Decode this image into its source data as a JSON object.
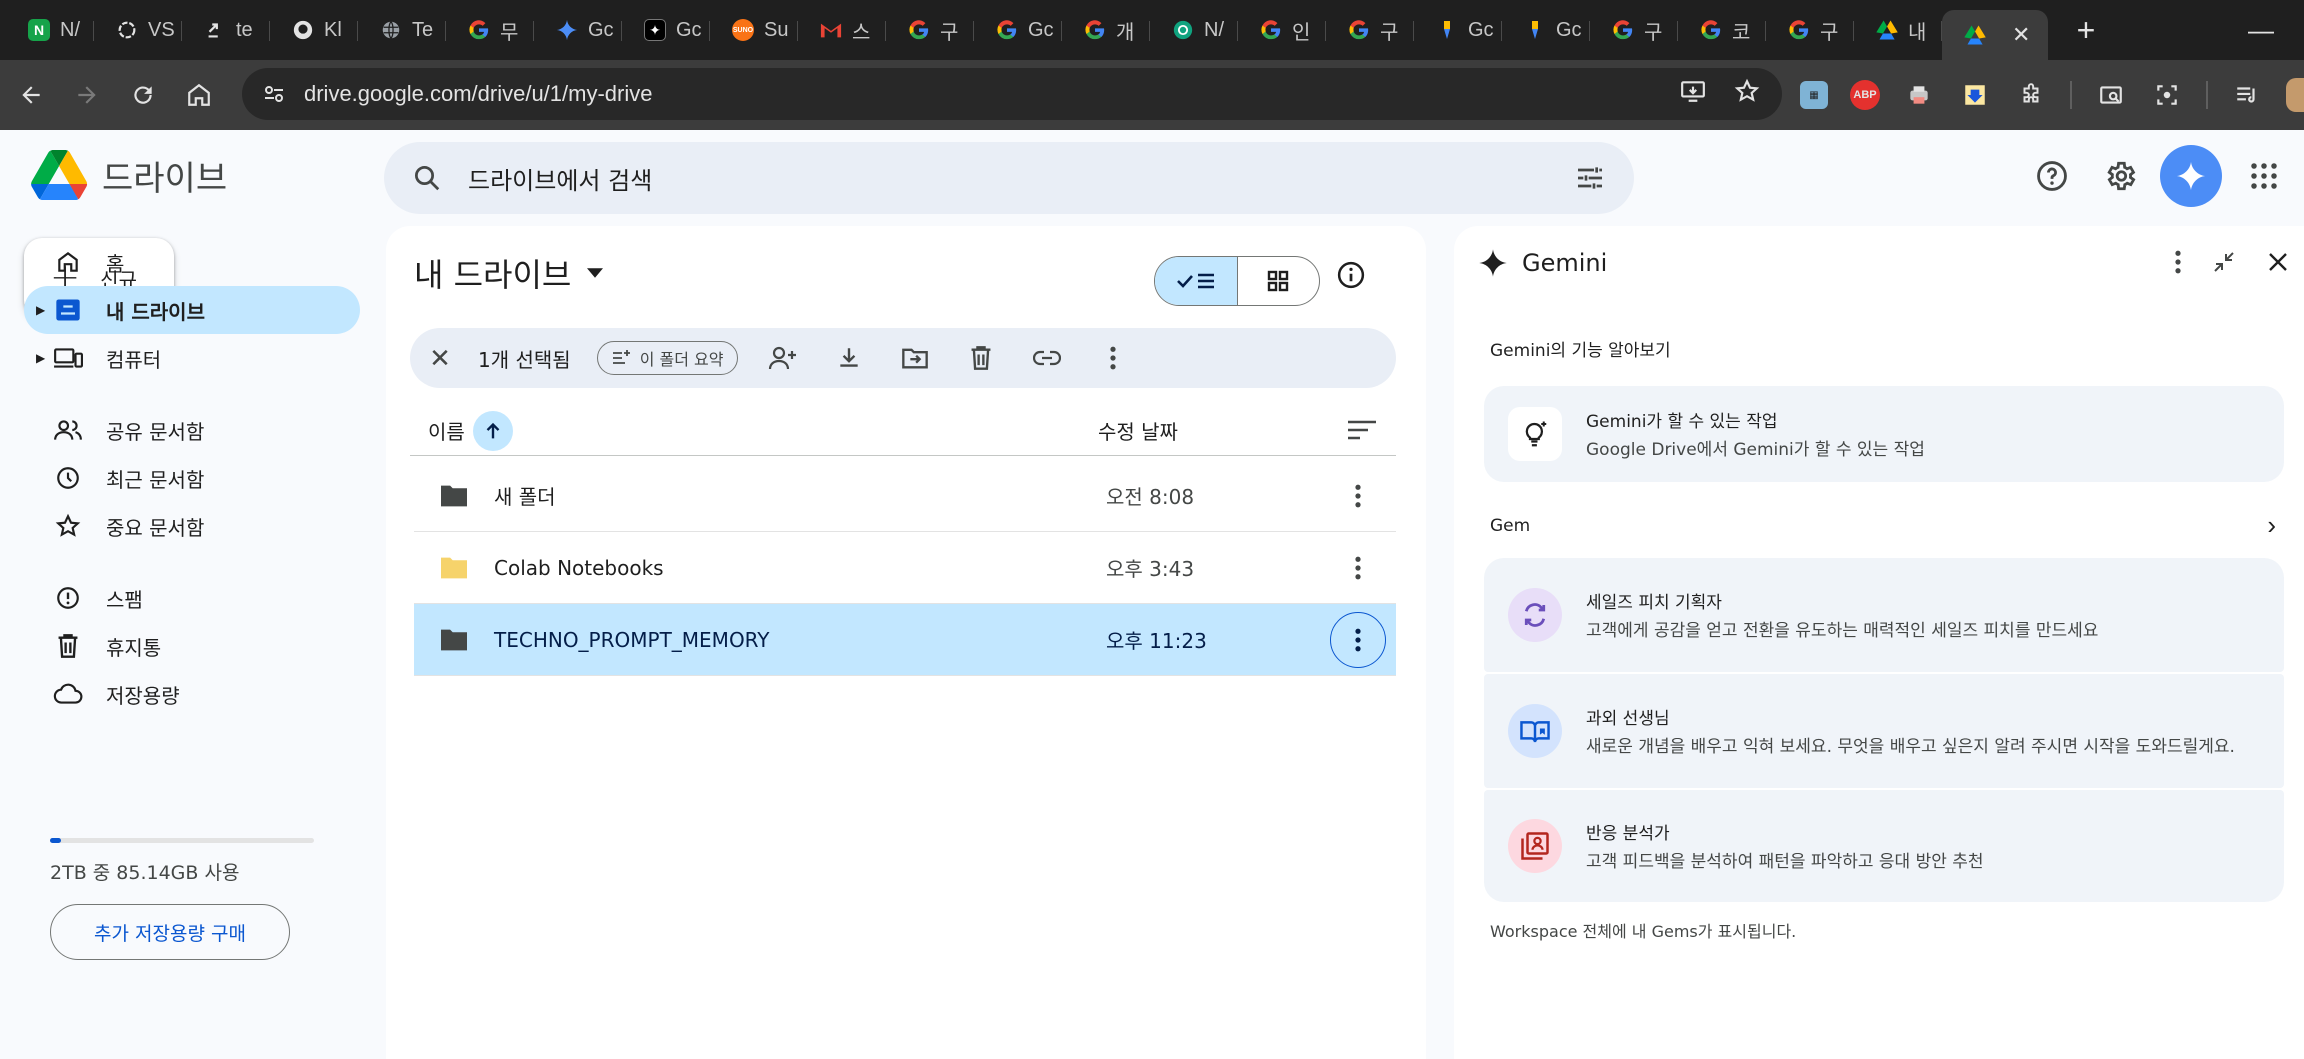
{
  "browser": {
    "tabs": [
      {
        "label": "N/",
        "icon": "notion-icon",
        "color": "#16a34a"
      },
      {
        "label": "VS",
        "icon": "openai-icon",
        "color": "#e3e3e3"
      },
      {
        "label": "te",
        "icon": "link-icon",
        "color": "#e3e3e3"
      },
      {
        "label": "Kl",
        "icon": "github-icon",
        "color": "#e3e3e3"
      },
      {
        "label": "Te",
        "icon": "globe-icon",
        "color": "#9aa0a6"
      },
      {
        "label": "무",
        "icon": "google-icon",
        "color": "#4285f4"
      },
      {
        "label": "Gc",
        "icon": "gemini-icon",
        "color": "#4c8df6"
      },
      {
        "label": "Gc",
        "icon": "gemini-dark-icon",
        "color": "#000000"
      },
      {
        "label": "Su",
        "icon": "suno-icon",
        "color": "#f97316"
      },
      {
        "label": "스",
        "icon": "gmail-icon",
        "color": "#ea4335"
      },
      {
        "label": "구",
        "icon": "google-icon",
        "color": "#4285f4"
      },
      {
        "label": "Gc",
        "icon": "google-icon",
        "color": "#4285f4"
      },
      {
        "label": "개",
        "icon": "google-icon",
        "color": "#4285f4"
      },
      {
        "label": "N/",
        "icon": "chatgpt-icon",
        "color": "#10a37f"
      },
      {
        "label": "인",
        "icon": "google-icon",
        "color": "#4285f4"
      },
      {
        "label": "구",
        "icon": "google-icon",
        "color": "#4285f4"
      },
      {
        "label": "Gc",
        "icon": "google-ai-icon",
        "color": "#fbbc04"
      },
      {
        "label": "Gc",
        "icon": "google-ai-icon",
        "color": "#fbbc04"
      },
      {
        "label": "구",
        "icon": "google-icon",
        "color": "#4285f4"
      },
      {
        "label": "코",
        "icon": "google-icon",
        "color": "#4285f4"
      },
      {
        "label": "구",
        "icon": "google-icon",
        "color": "#4285f4"
      },
      {
        "label": "내",
        "icon": "drive-icon",
        "color": "#34a853"
      },
      {
        "label": "",
        "icon": "drive-icon",
        "color": "#34a853",
        "active": true
      }
    ],
    "active_tab_close": "✕",
    "new_tab": "+",
    "url": "drive.google.com/drive/u/1/my-drive"
  },
  "drive": {
    "app_name": "드라이브",
    "search_placeholder": "드라이브에서 검색",
    "new_button": "신규",
    "nav": [
      {
        "label": "홈",
        "icon": "home-icon"
      },
      {
        "label": "내 드라이브",
        "icon": "my-drive-icon",
        "active": true,
        "caret": true
      },
      {
        "label": "컴퓨터",
        "icon": "computers-icon",
        "caret": true
      },
      {
        "label": "공유 문서함",
        "icon": "shared-icon"
      },
      {
        "label": "최근 문서함",
        "icon": "clock-icon"
      },
      {
        "label": "중요 문서함",
        "icon": "star-icon"
      },
      {
        "label": "스팸",
        "icon": "spam-icon"
      },
      {
        "label": "휴지통",
        "icon": "trash-icon"
      },
      {
        "label": "저장용량",
        "icon": "cloud-icon"
      }
    ],
    "storage_text": "2TB 중 85.14GB 사용",
    "storage_fraction": 0.042,
    "buy_storage": "추가 저장용량 구매",
    "title": "내 드라이브",
    "selection": {
      "count_text": "1개 선택됨",
      "summarize_chip": "이 폴더 요약"
    },
    "columns": {
      "name": "이름",
      "modified": "수정 날짜"
    },
    "rows": [
      {
        "name": "새 폴더",
        "modified": "오전 8:08",
        "folder_color": "#444746",
        "selected": false
      },
      {
        "name": "Colab Notebooks",
        "modified": "오후 3:43",
        "folder_color": "#f6d36b",
        "selected": false
      },
      {
        "name": "TECHNO_PROMPT_MEMORY",
        "modified": "오후 11:23",
        "folder_color": "#444746",
        "selected": true
      }
    ]
  },
  "gemini": {
    "title": "Gemini",
    "intro_label": "Gemini의 기능 알아보기",
    "feature_card": {
      "title": "Gemini가 할 수 있는 작업",
      "desc": "Google Drive에서 Gemini가 할 수 있는 작업"
    },
    "gem_label": "Gem",
    "gems": [
      {
        "title": "세일즈 피치 기획자",
        "desc": "고객에게 공감을 얻고 전환을 유도하는 매력적인 세일즈 피치를 만드세요",
        "color": "#e8def8"
      },
      {
        "title": "과외 선생님",
        "desc": "새로운 개념을 배우고 익혀 보세요. 무엇을 배우고 싶은지 알려 주시면 시작을 도와드릴게요.",
        "color": "#d3e3fd"
      },
      {
        "title": "반응 분석가",
        "desc": "고객 피드백을 분석하여 패턴을 파악하고 응대 방안 추천",
        "color": "#fdd8e0"
      }
    ],
    "footer": "Workspace 전체에 내 Gems가 표시됩니다."
  }
}
